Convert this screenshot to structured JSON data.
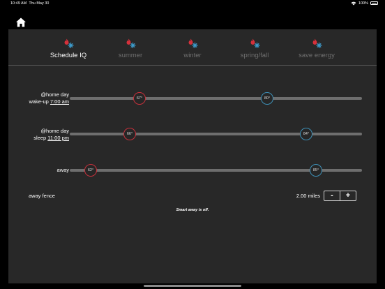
{
  "status_bar": {
    "time": "10:49 AM",
    "date": "Thu May 30",
    "battery": "100%"
  },
  "colors": {
    "heat": "#c8313c",
    "cool": "#3d8fb6",
    "panel": "#282828",
    "inactive_tab": "#6f6f6f"
  },
  "nav": {
    "home_icon": "home-icon"
  },
  "tabs": [
    {
      "label": "Schedule IQ",
      "active": true
    },
    {
      "label": "summer",
      "active": false
    },
    {
      "label": "winter",
      "active": false
    },
    {
      "label": "spring/fall",
      "active": false
    },
    {
      "label": "save energy",
      "active": false
    }
  ],
  "rows": [
    {
      "line1": "@home day",
      "line2_prefix": "wake-up",
      "line2_time": "7:00 am",
      "heat": "67°",
      "cool": "80°"
    },
    {
      "line1": "@home day",
      "line2_prefix": "sleep",
      "line2_time": "11:00 pm",
      "heat": "66°",
      "cool": "84°"
    },
    {
      "line1": "away",
      "heat": "62°",
      "cool": "85°"
    }
  ],
  "away_fence": {
    "label": "away fence",
    "value": "2.00 miles",
    "minus": "-",
    "plus": "+"
  },
  "note": "Smart away is off."
}
